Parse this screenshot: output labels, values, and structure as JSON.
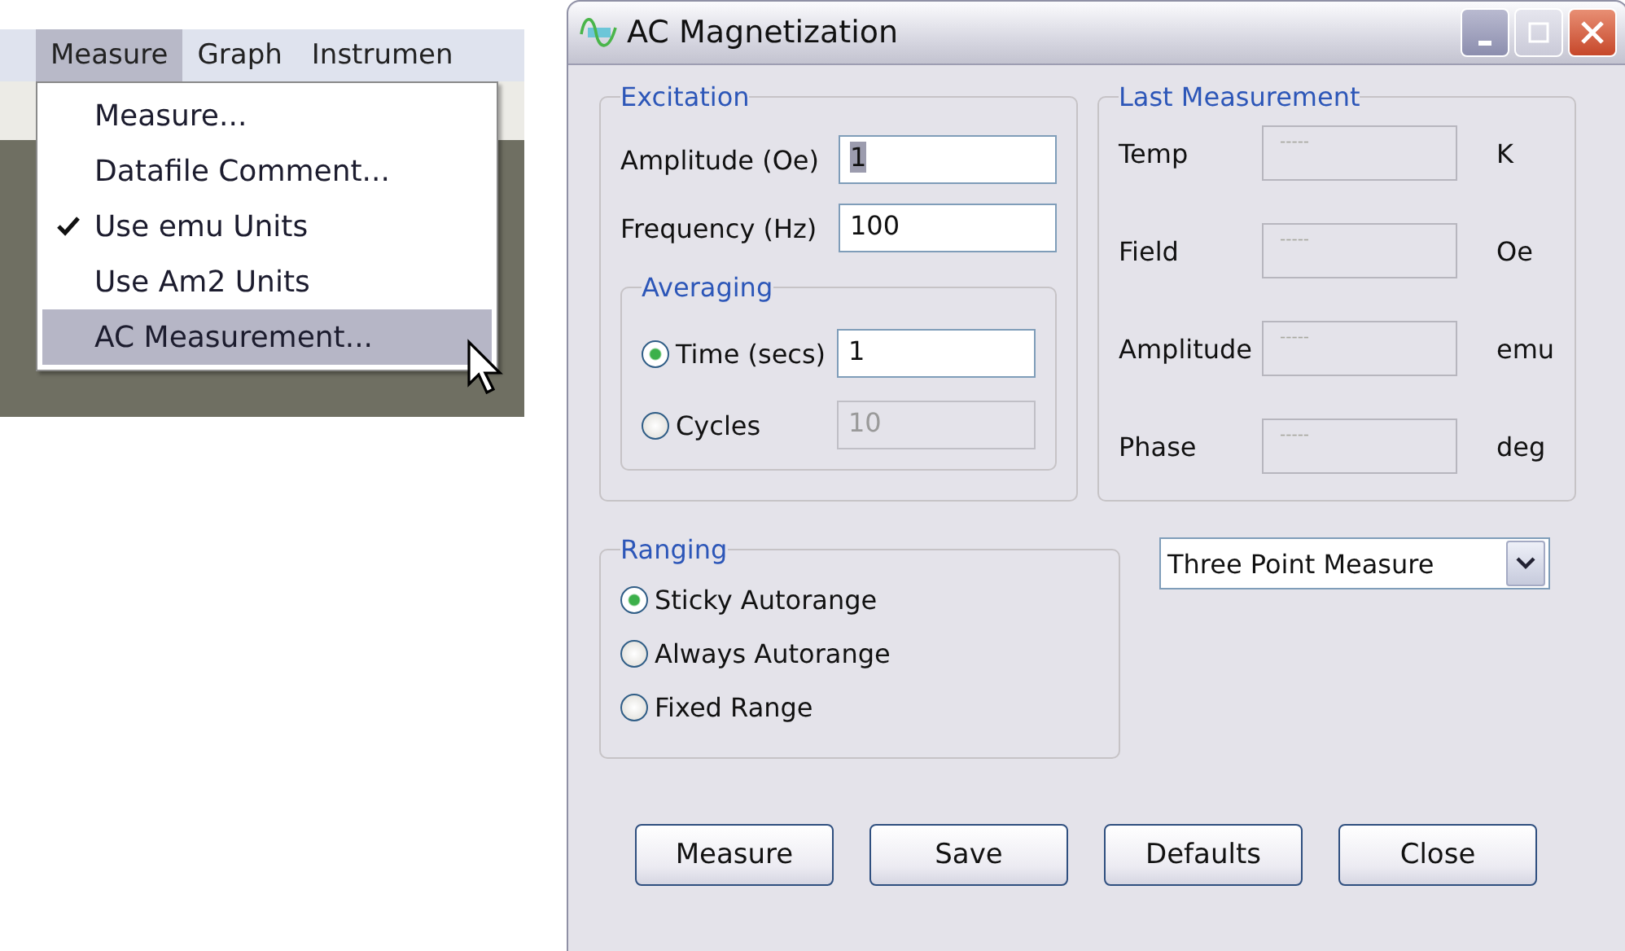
{
  "menubar": {
    "items": [
      {
        "label": "Measure",
        "selected": true
      },
      {
        "label": "Graph",
        "selected": false
      },
      {
        "label": "Instrumen",
        "selected": false
      }
    ]
  },
  "menu": {
    "items": [
      {
        "label": "Measure...",
        "checked": false,
        "selected": false
      },
      {
        "label": "Datafile Comment...",
        "checked": false,
        "selected": false
      },
      {
        "label": "Use emu Units",
        "checked": true,
        "selected": false
      },
      {
        "label": "Use Am2 Units",
        "checked": false,
        "selected": false
      },
      {
        "label": "AC Measurement...",
        "checked": false,
        "selected": true
      }
    ]
  },
  "window": {
    "title": "AC Magnetization"
  },
  "excitation": {
    "title": "Excitation",
    "fields": [
      {
        "label": "Amplitude (Oe)",
        "value": "1",
        "selected": true
      },
      {
        "label": "Frequency (Hz)",
        "value": "100",
        "selected": false
      }
    ],
    "averaging": {
      "title": "Averaging",
      "options": [
        {
          "label": "Time (secs)",
          "selected": true,
          "value": "1",
          "disabled": false
        },
        {
          "label": "Cycles",
          "selected": false,
          "value": "10",
          "disabled": true
        }
      ]
    }
  },
  "last_measurement": {
    "title": "Last Measurement",
    "rows": [
      {
        "label": "Temp",
        "placeholder": "-----",
        "unit": "K"
      },
      {
        "label": "Field",
        "placeholder": "-----",
        "unit": "Oe"
      },
      {
        "label": "Amplitude",
        "placeholder": "-----",
        "unit": "emu"
      },
      {
        "label": "Phase",
        "placeholder": "-----",
        "unit": "deg"
      }
    ]
  },
  "ranging": {
    "title": "Ranging",
    "options": [
      {
        "label": "Sticky Autorange",
        "selected": true
      },
      {
        "label": "Always Autorange",
        "selected": false
      },
      {
        "label": "Fixed Range",
        "selected": false
      }
    ]
  },
  "mode_select": {
    "value": "Three Point Measure"
  },
  "buttons": [
    "Measure",
    "Save",
    "Defaults",
    "Close"
  ]
}
